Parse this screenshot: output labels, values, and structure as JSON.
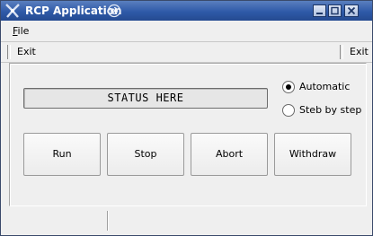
{
  "window": {
    "title": "RCP Application",
    "colors": {
      "titlebar": "#2f5aa8",
      "background": "#efefef"
    },
    "controls": {
      "minimize_icon": "minimize-icon",
      "maximize_icon": "maximize-icon",
      "close_icon": "close-icon"
    }
  },
  "menubar": {
    "file_label": "File"
  },
  "toolbar": {
    "left_exit": "Exit",
    "right_exit": "Exit"
  },
  "main": {
    "status_text": "STATUS HERE",
    "modes": [
      {
        "label": "Automatic",
        "selected": true
      },
      {
        "label": "Steb by step",
        "selected": false
      }
    ],
    "buttons": [
      "Run",
      "Stop",
      "Abort",
      "Withdraw"
    ]
  }
}
